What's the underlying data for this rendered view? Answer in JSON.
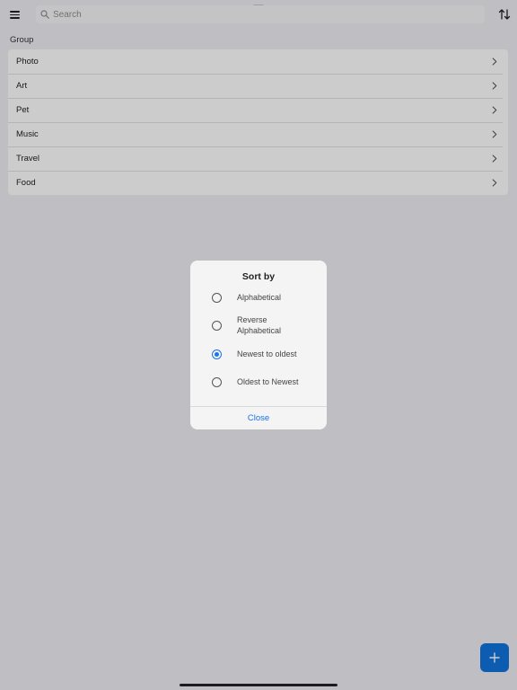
{
  "search": {
    "placeholder": "Search"
  },
  "section_title": "Group",
  "groups": [
    {
      "label": "Photo"
    },
    {
      "label": "Art"
    },
    {
      "label": "Pet"
    },
    {
      "label": "Music"
    },
    {
      "label": "Travel"
    },
    {
      "label": "Food"
    }
  ],
  "sort_dialog": {
    "title": "Sort by",
    "options": [
      {
        "label": "Alphabetical",
        "selected": false
      },
      {
        "label": "Reverse\nAlphabetical",
        "selected": false
      },
      {
        "label": "Newest to oldest",
        "selected": true
      },
      {
        "label": "Oldest to Newest",
        "selected": false
      }
    ],
    "close_label": "Close"
  },
  "icons": {
    "menu": "hamburger-menu-icon",
    "search": "magnifier-icon",
    "sort": "sort-arrows-icon",
    "chevron": "chevron-right-icon",
    "add": "plus-icon"
  },
  "colors": {
    "accent": "#1a73e8",
    "fab": "#0f73de",
    "background": "#efeff4"
  }
}
